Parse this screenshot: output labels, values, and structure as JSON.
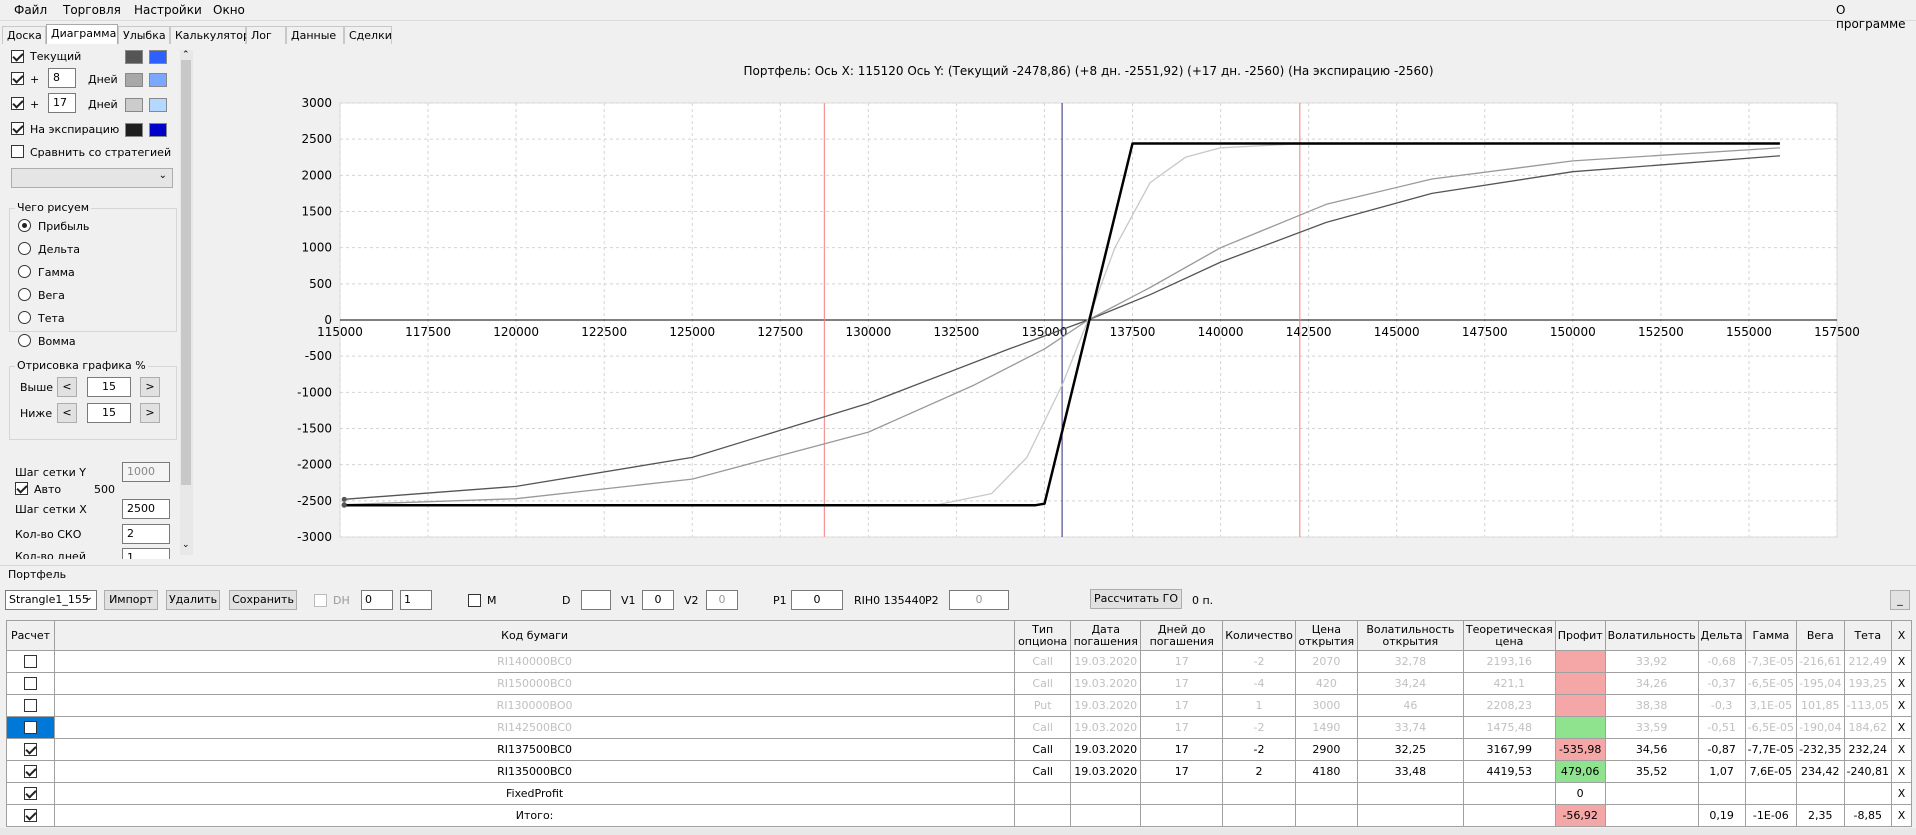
{
  "menu": {
    "items": [
      "Файл",
      "Торговля",
      "Настройки",
      "Окно"
    ],
    "about": "О программе"
  },
  "tabs": [
    "Доска",
    "Диаграмма",
    "Улыбка",
    "Калькулятор",
    "Лог",
    "Данные",
    "Сделки"
  ],
  "left": {
    "current_label": "Текущий",
    "plus": "+",
    "days1": "8",
    "days2": "17",
    "days_label": "Дней",
    "expiry_label": "На экспирацию",
    "compare_label": "Сравнить со стратегией",
    "draw_group": "Чего рисуем",
    "radios": [
      "Прибыль",
      "Дельта",
      "Гамма",
      "Вега",
      "Тета",
      "Вомма"
    ],
    "render_group": "Отрисовка графика %",
    "above_label": "Выше",
    "below_label": "Ниже",
    "above_val": "15",
    "below_val": "15",
    "gridy_label": "Шаг сетки Y",
    "gridy_val": "1000",
    "auto_label": "Авто",
    "auto_val": "500",
    "gridx_label": "Шаг сетки X",
    "gridx_val": "2500",
    "sko_label": "Кол-во СКО",
    "sko_val": "2",
    "days_cut_label": "Кол-во дней",
    "days_cut_val": "1",
    "swatch_colors": [
      [
        "#555555",
        "#2f5fff"
      ],
      [
        "#a8a8a8",
        "#7aa8ff"
      ],
      [
        "#cccccc",
        "#b4d8ff"
      ],
      [
        "#1e1e1e",
        "#0000c8"
      ]
    ]
  },
  "chart_data": {
    "type": "line",
    "title": "Портфель:  Ось X:  115120  Ось Y:   (Текущий -2478,86)   (+8 дн. -2551,92)   (+17 дн. -2560)   (На экспирацию -2560)",
    "xlim": [
      115000,
      157500
    ],
    "ylim": [
      -3000,
      3000
    ],
    "xticks": [
      115000,
      117500,
      120000,
      122500,
      125000,
      127500,
      130000,
      132500,
      135000,
      137500,
      140000,
      142500,
      145000,
      147500,
      150000,
      152500,
      155000,
      157500
    ],
    "yticks": [
      3000,
      2500,
      2000,
      1500,
      1000,
      500,
      0,
      -500,
      -1000,
      -1500,
      -2000,
      -2500,
      -3000
    ],
    "vlines_red": [
      128750,
      142250
    ],
    "vline_blue": 135500,
    "series": [
      {
        "color": "#555555",
        "x": [
          115120,
          120000,
          125000,
          130000,
          134000,
          136240,
          138000,
          140000,
          143000,
          146000,
          150000,
          155880
        ],
        "y": [
          -2479,
          -2300,
          -1900,
          -1150,
          -400,
          0,
          350,
          800,
          1350,
          1750,
          2050,
          2270
        ]
      },
      {
        "color": "#999999",
        "x": [
          115120,
          120000,
          125000,
          130000,
          133000,
          135000,
          136240,
          138000,
          140000,
          143000,
          146000,
          150000,
          155880
        ],
        "y": [
          -2552,
          -2470,
          -2200,
          -1550,
          -900,
          -400,
          0,
          450,
          1000,
          1600,
          1950,
          2200,
          2380
        ]
      },
      {
        "color": "#c8c8c8",
        "x": [
          115120,
          130000,
          132000,
          133500,
          134500,
          135500,
          136240,
          137000,
          138000,
          139000,
          140000,
          142000,
          155880
        ],
        "y": [
          -2560,
          -2560,
          -2550,
          -2400,
          -1900,
          -900,
          0,
          1000,
          1900,
          2250,
          2380,
          2430,
          2440
        ]
      },
      {
        "color": "#000000",
        "x": [
          115120,
          134750,
          135000,
          137500,
          137700,
          155880
        ],
        "y": [
          -2560,
          -2560,
          -2540,
          2440,
          2440,
          2440
        ]
      }
    ]
  },
  "portfolio": {
    "label": "Портфель",
    "strategy": "Strangle1_155",
    "import": "Импорт",
    "delete": "Удалить",
    "save": "Сохранить",
    "dh": "DH",
    "spin1": "0",
    "spin2": "1",
    "m": "M",
    "d": "D",
    "v1": "V1",
    "v1_val": "0",
    "v2": "V2",
    "v2_val": "0",
    "p1": "P1",
    "p1_val": "0",
    "rih": "RIH0 135440",
    "p2": "P2",
    "p2_val": "0",
    "calc_go": "Рассчитать ГО",
    "go_val": "0 п.",
    "minimize": "_"
  },
  "table": {
    "headers": [
      "Расчет",
      "Код бумаги",
      "Тип опциона",
      "Дата погашения",
      "Дней до погашения",
      "Количество",
      "Цена открытия",
      "Волатильность открытия",
      "Теоретическая цена",
      "Профит",
      "Волатильность",
      "Дельта",
      "Гамма",
      "Вега",
      "Тета",
      "X"
    ],
    "rows": [
      {
        "checked": false,
        "dim": true,
        "code": "RI140000BC0",
        "type": "Call",
        "date": "19.03.2020",
        "days": "17",
        "qty": "-2",
        "price": "2070",
        "vol_open": "32,78",
        "theo": "2193,16",
        "profit": "",
        "pcls": "neg",
        "vol": "33,92",
        "delta": "-0,68",
        "gamma": "-7,3E-05",
        "vega": "-216,61",
        "theta": "212,49"
      },
      {
        "checked": false,
        "dim": true,
        "code": "RI150000BC0",
        "type": "Call",
        "date": "19.03.2020",
        "days": "17",
        "qty": "-4",
        "price": "420",
        "vol_open": "34,24",
        "theo": "421,1",
        "profit": "",
        "pcls": "neg",
        "vol": "34,26",
        "delta": "-0,37",
        "gamma": "-6,5E-05",
        "vega": "-195,04",
        "theta": "193,25"
      },
      {
        "checked": false,
        "dim": true,
        "code": "RI130000BO0",
        "type": "Put",
        "date": "19.03.2020",
        "days": "17",
        "qty": "1",
        "price": "3000",
        "vol_open": "46",
        "theo": "2208,23",
        "profit": "",
        "pcls": "neg",
        "vol": "38,38",
        "delta": "-0,3",
        "gamma": "3,1E-05",
        "vega": "101,85",
        "theta": "-113,05"
      },
      {
        "checked": false,
        "dim": true,
        "selected": true,
        "code": "RI142500BC0",
        "type": "Call",
        "date": "19.03.2020",
        "days": "17",
        "qty": "-2",
        "price": "1490",
        "vol_open": "33,74",
        "theo": "1475,48",
        "profit": "",
        "pcls": "pos",
        "vol": "33,59",
        "delta": "-0,51",
        "gamma": "-6,5E-05",
        "vega": "-190,04",
        "theta": "184,62"
      },
      {
        "checked": true,
        "dim": false,
        "code": "RI137500BC0",
        "type": "Call",
        "date": "19.03.2020",
        "days": "17",
        "qty": "-2",
        "price": "2900",
        "vol_open": "32,25",
        "theo": "3167,99",
        "profit": "-535,98",
        "pcls": "neg",
        "vol": "34,56",
        "delta": "-0,87",
        "gamma": "-7,7E-05",
        "vega": "-232,35",
        "theta": "232,24"
      },
      {
        "checked": true,
        "dim": false,
        "code": "RI135000BC0",
        "type": "Call",
        "date": "19.03.2020",
        "days": "17",
        "qty": "2",
        "price": "4180",
        "vol_open": "33,48",
        "theo": "4419,53",
        "profit": "479,06",
        "pcls": "pos",
        "vol": "35,52",
        "delta": "1,07",
        "gamma": "7,6E-05",
        "vega": "234,42",
        "theta": "-240,81"
      },
      {
        "checked": true,
        "dim": false,
        "code": "FixedProfit",
        "type": "",
        "date": "",
        "days": "",
        "qty": "",
        "price": "",
        "vol_open": "",
        "theo": "",
        "profit": "0",
        "pcls": "",
        "vol": "",
        "delta": "",
        "gamma": "",
        "vega": "",
        "theta": ""
      },
      {
        "checked": true,
        "dim": false,
        "code": "Итого:",
        "type": "",
        "date": "",
        "days": "",
        "qty": "",
        "price": "",
        "vol_open": "",
        "theo": "",
        "profit": "-56,92",
        "pcls": "neg",
        "vol": "",
        "delta": "0,19",
        "gamma": "-1E-06",
        "vega": "2,35",
        "theta": "-8,85"
      }
    ],
    "close_glyph": "X"
  }
}
